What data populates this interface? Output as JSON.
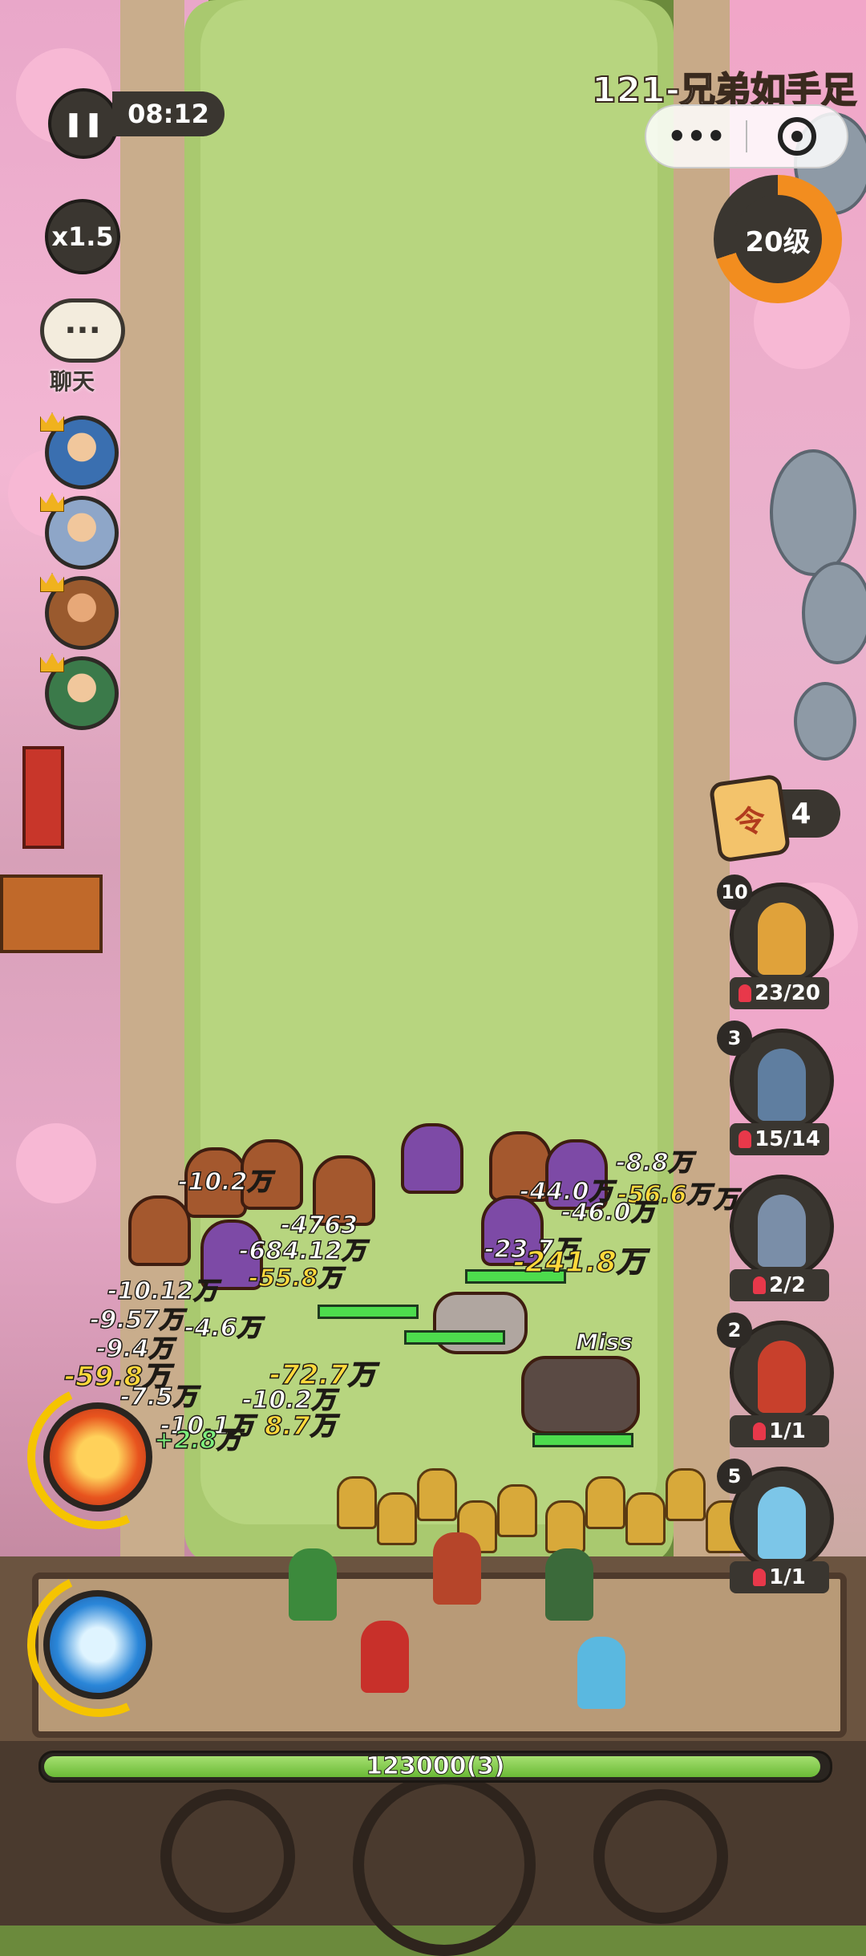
{
  "hud": {
    "timer": "08:12",
    "speed_label": "x1.5",
    "chat_label": "聊天",
    "chat_icon": "···",
    "stage_title": "121-兄弟如手足",
    "more_icon": "•••",
    "level_label": "20级",
    "level_progress_fraction": 0.7,
    "token_glyph": "令",
    "token_count": "4",
    "pause_icon": "❚❚"
  },
  "heroes": [
    {
      "name": "hero-portrait-1",
      "icon": "crown-icon"
    },
    {
      "name": "hero-portrait-2",
      "icon": "crown-icon"
    },
    {
      "name": "hero-portrait-3",
      "icon": "crown-icon"
    },
    {
      "name": "hero-portrait-4",
      "icon": "crown-icon"
    }
  ],
  "units": [
    {
      "level": "10",
      "count": "23/20",
      "color": "#e0a23a"
    },
    {
      "level": "3",
      "count": "15/14",
      "color": "#5f7ea0"
    },
    {
      "level": "",
      "count": "2/2",
      "color": "#7a8ea8"
    },
    {
      "level": "2",
      "count": "1/1",
      "color": "#c8402c"
    },
    {
      "level": "5",
      "count": "1/1",
      "color": "#7cc6e8"
    }
  ],
  "damage_numbers": [
    {
      "text": "-10.2万",
      "style": "w"
    },
    {
      "text": "-8.8万",
      "style": "w"
    },
    {
      "text": "-44.0万",
      "style": "w"
    },
    {
      "text": "-56.6万",
      "style": "y"
    },
    {
      "text": "万",
      "style": "w"
    },
    {
      "text": "-46.0万",
      "style": "w"
    },
    {
      "text": "-4763",
      "style": "w"
    },
    {
      "text": "-684.12万",
      "style": "w"
    },
    {
      "text": "-23.7万",
      "style": "w"
    },
    {
      "text": "-55.8万",
      "style": "y"
    },
    {
      "text": "-241.8万",
      "style": "y"
    },
    {
      "text": "-10.12万",
      "style": "w"
    },
    {
      "text": "-9.57万",
      "style": "w"
    },
    {
      "text": "-4.6万",
      "style": "w"
    },
    {
      "text": "-9.4万",
      "style": "w"
    },
    {
      "text": "-59.8万",
      "style": "y"
    },
    {
      "text": "-72.7万",
      "style": "y"
    },
    {
      "text": "-10.2万",
      "style": "w"
    },
    {
      "text": "-7.5万",
      "style": "w"
    },
    {
      "text": "-10.1万",
      "style": "w"
    },
    {
      "text": "8.7万",
      "style": "y"
    },
    {
      "text": "+2.8万",
      "style": "g"
    },
    {
      "text": "Miss",
      "style": "w"
    }
  ],
  "wall": {
    "hp_text": "123000(3)",
    "hp_fraction": 1.0
  },
  "skills": [
    {
      "name": "hammer-skill",
      "color": "#e8541e",
      "charge_fraction": 0.6
    },
    {
      "name": "wave-skill",
      "color": "#2a86d8",
      "charge_fraction": 0.5
    }
  ]
}
